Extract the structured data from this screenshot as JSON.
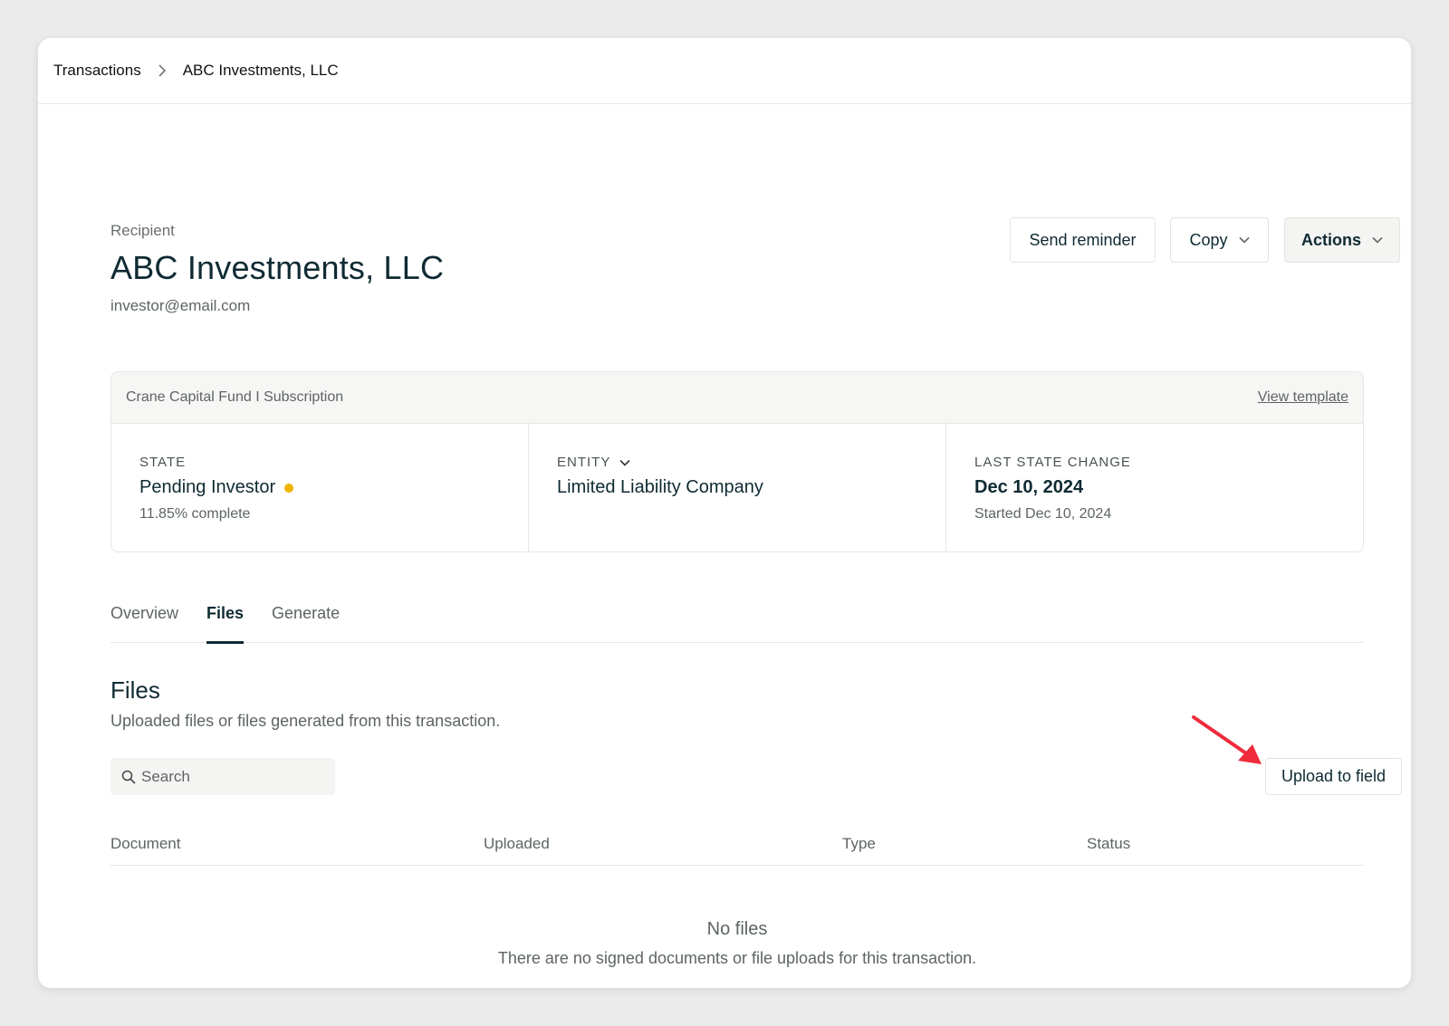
{
  "breadcrumb": {
    "parent": "Transactions",
    "current": "ABC Investments, LLC"
  },
  "recipient": {
    "label": "Recipient",
    "name": "ABC Investments, LLC",
    "email": "investor@email.com"
  },
  "header_actions": {
    "send_reminder": "Send reminder",
    "copy": "Copy",
    "actions": "Actions"
  },
  "summary_card": {
    "title": "Crane Capital Fund I Subscription",
    "view_template": "View template",
    "state": {
      "label": "STATE",
      "value": "Pending Investor",
      "status_color": "#f2b300",
      "sub": "11.85% complete"
    },
    "entity": {
      "label": "ENTITY",
      "value": "Limited Liability Company"
    },
    "last_state_change": {
      "label": "LAST STATE CHANGE",
      "value": "Dec 10, 2024",
      "sub": "Started Dec 10, 2024"
    }
  },
  "tabs": [
    {
      "label": "Overview",
      "active": false
    },
    {
      "label": "Files",
      "active": true
    },
    {
      "label": "Generate",
      "active": false
    }
  ],
  "files_section": {
    "title": "Files",
    "subtitle": "Uploaded files or files generated from this transaction.",
    "search_placeholder": "Search",
    "upload_button": "Upload to field",
    "columns": [
      "Document",
      "Uploaded",
      "Type",
      "Status"
    ],
    "empty_title": "No files",
    "empty_message": "There are no signed documents or file uploads for this transaction."
  },
  "colors": {
    "primary_text": "#0f2a33",
    "annotation_arrow": "#ef2b3b"
  }
}
